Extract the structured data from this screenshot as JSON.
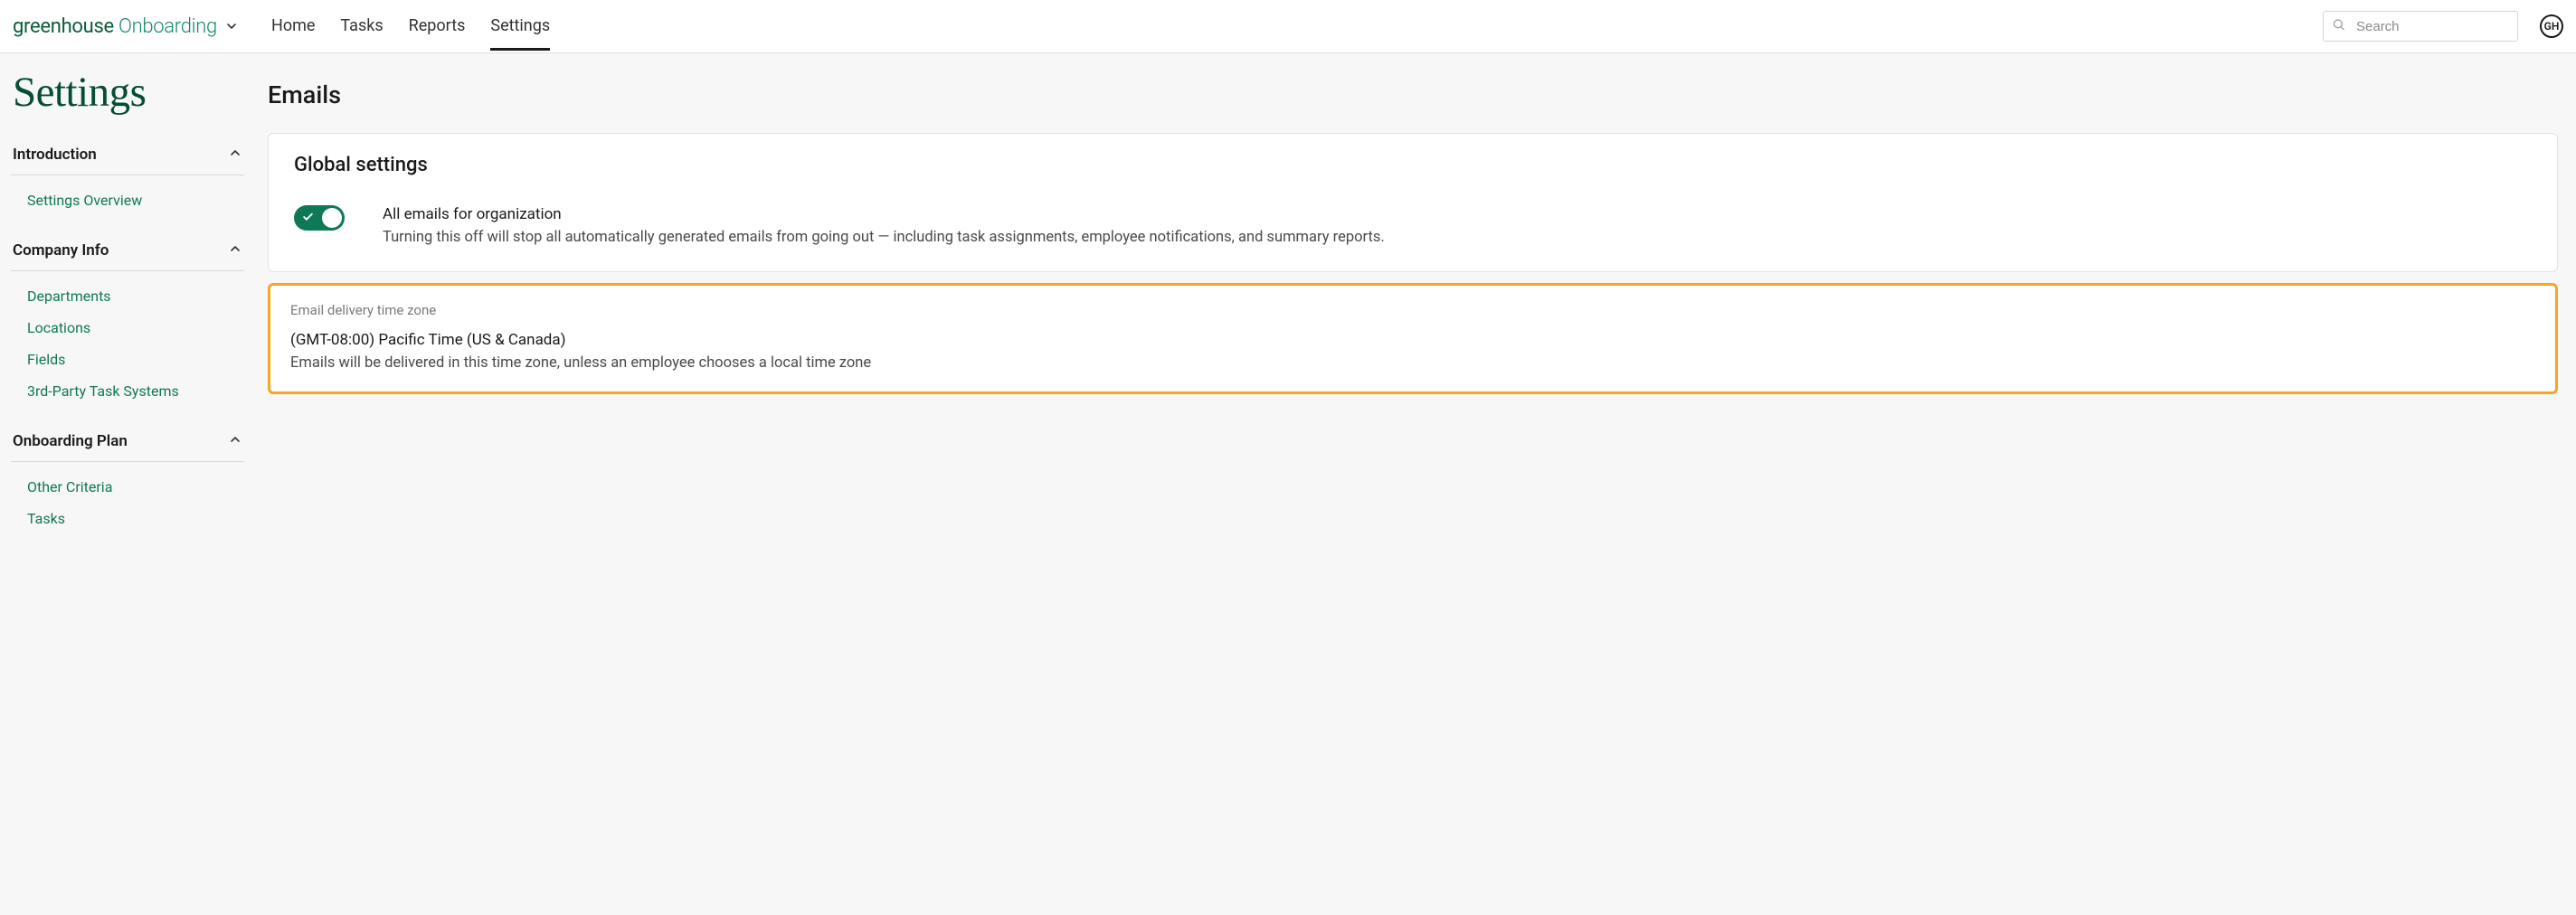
{
  "brand": {
    "part1": "greenhouse",
    "part2": " Onboarding"
  },
  "nav": {
    "home": "Home",
    "tasks": "Tasks",
    "reports": "Reports",
    "settings": "Settings"
  },
  "search": {
    "placeholder": "Search"
  },
  "avatar": {
    "initials": "GH"
  },
  "page_title": "Settings",
  "sidebar": {
    "introduction": {
      "label": "Introduction",
      "items": [
        "Settings Overview"
      ]
    },
    "company_info": {
      "label": "Company Info",
      "items": [
        "Departments",
        "Locations",
        "Fields",
        "3rd-Party Task Systems"
      ]
    },
    "onboarding_plan": {
      "label": "Onboarding Plan",
      "items": [
        "Other Criteria",
        "Tasks"
      ]
    }
  },
  "main": {
    "section_title": "Emails",
    "global_card": {
      "title": "Global settings",
      "toggle_on": true,
      "toggle_title": "All emails for organization",
      "toggle_desc": "Turning this off will stop all automatically generated emails from going out — including task assignments, employee notifications, and summary reports."
    },
    "tz_card": {
      "label": "Email delivery time zone",
      "value": "(GMT-08:00) Pacific Time (US & Canada)",
      "desc": "Emails will be delivered in this time zone, unless an employee chooses a local time zone"
    }
  }
}
